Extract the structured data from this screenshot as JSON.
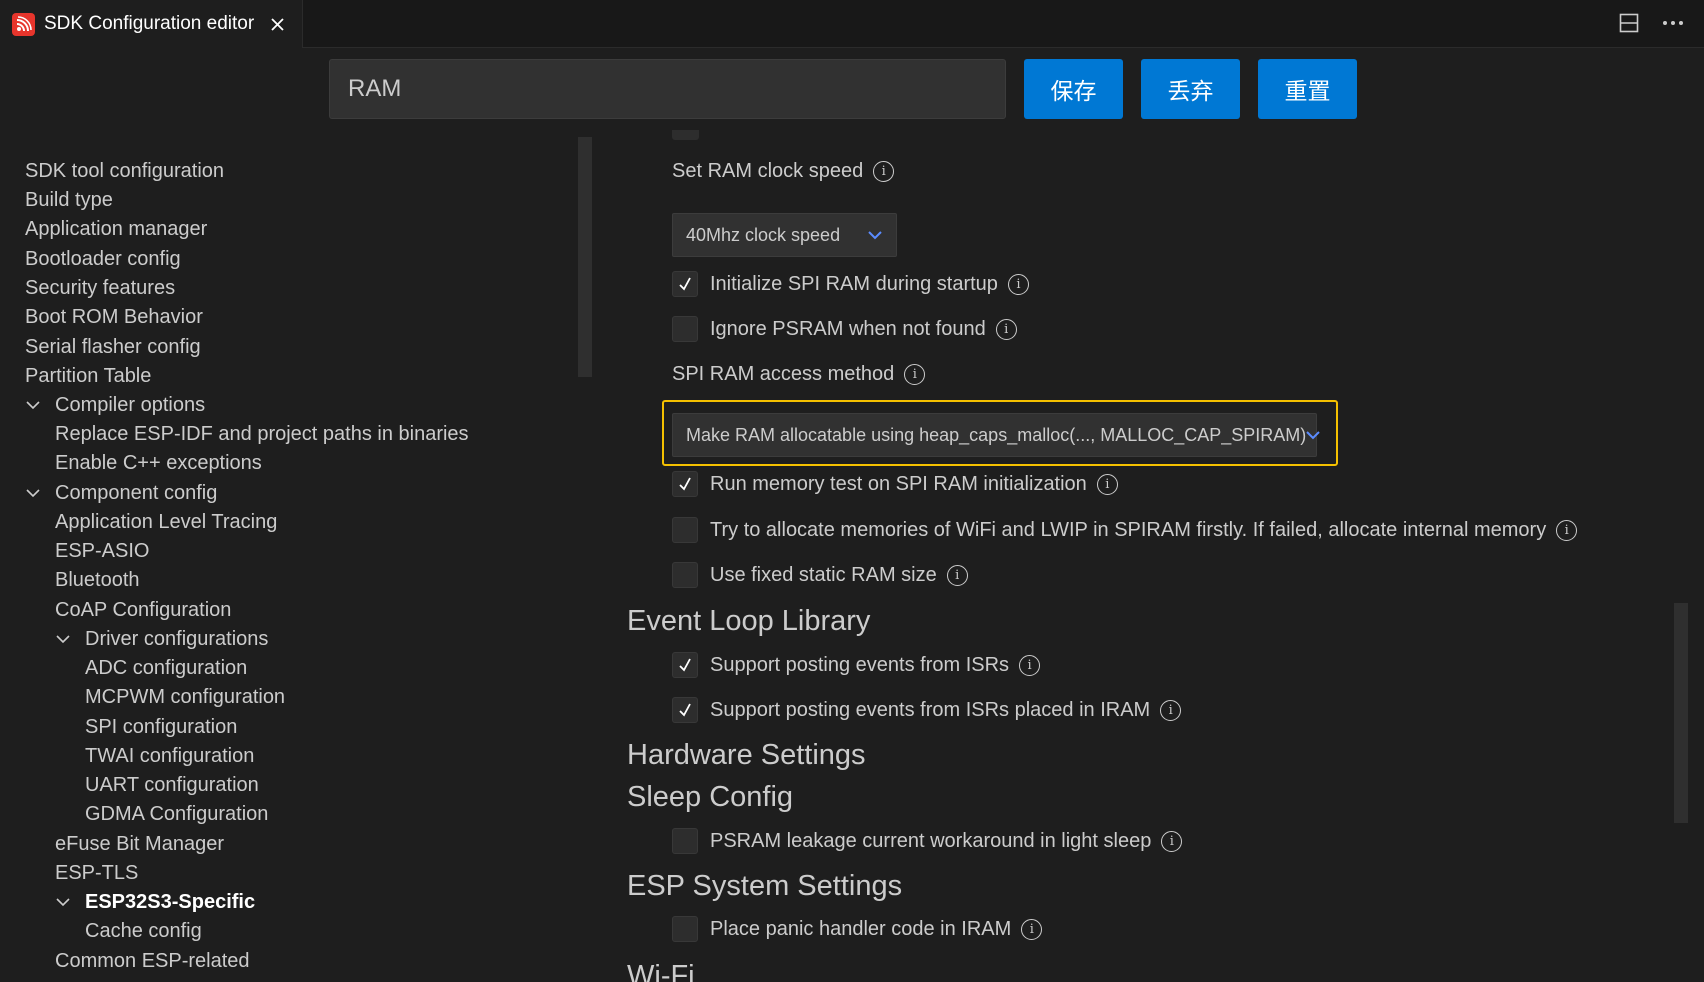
{
  "tab": {
    "title": "SDK Configuration editor",
    "logo_icon": "espressif-logo-icon",
    "close_icon": "close-icon"
  },
  "toolbar": {
    "split_icon": "split-editor-icon",
    "more_icon": "more-actions-icon"
  },
  "search": {
    "value": "RAM"
  },
  "buttons": {
    "save": "保存",
    "discard": "丢弃",
    "reset": "重置"
  },
  "sidebar": {
    "items": [
      {
        "label": "SDK tool configuration"
      },
      {
        "label": "Build type"
      },
      {
        "label": "Application manager"
      },
      {
        "label": "Bootloader config"
      },
      {
        "label": "Security features"
      },
      {
        "label": "Boot ROM Behavior"
      },
      {
        "label": "Serial flasher config"
      },
      {
        "label": "Partition Table"
      },
      {
        "label": "Compiler options"
      },
      {
        "label": "Replace ESP-IDF and project paths in binaries"
      },
      {
        "label": "Enable C++ exceptions"
      },
      {
        "label": "Component config"
      },
      {
        "label": "Application Level Tracing"
      },
      {
        "label": "ESP-ASIO"
      },
      {
        "label": "Bluetooth"
      },
      {
        "label": "CoAP Configuration"
      },
      {
        "label": "Driver configurations"
      },
      {
        "label": "ADC configuration"
      },
      {
        "label": "MCPWM configuration"
      },
      {
        "label": "SPI configuration"
      },
      {
        "label": "TWAI configuration"
      },
      {
        "label": "UART configuration"
      },
      {
        "label": "GDMA Configuration"
      },
      {
        "label": "eFuse Bit Manager"
      },
      {
        "label": "ESP-TLS"
      },
      {
        "label": "ESP32S3-Specific"
      },
      {
        "label": "Cache config"
      },
      {
        "label": "Common ESP-related"
      }
    ]
  },
  "main": {
    "ram_clock_label": "Set RAM clock speed",
    "ram_clock_value": "40Mhz clock speed",
    "init_spi_ram": "Initialize SPI RAM during startup",
    "ignore_psram": "Ignore PSRAM when not found",
    "access_method_label": "SPI RAM access method",
    "access_method_value": "Make RAM allocatable using heap_caps_malloc(..., MALLOC_CAP_SPIRAM)",
    "run_memtest": "Run memory test on SPI RAM initialization",
    "try_alloc_wifi": "Try to allocate memories of WiFi and LWIP in SPIRAM firstly. If failed, allocate internal memory",
    "fixed_static_ram": "Use fixed static RAM size",
    "section_event_loop": "Event Loop Library",
    "posting_isr": "Support posting events from ISRs",
    "posting_isr_iram": "Support posting events from ISRs placed in IRAM",
    "section_hardware": "Hardware Settings",
    "section_sleep": "Sleep Config",
    "psram_leakage": "PSRAM leakage current workaround in light sleep",
    "section_system": "ESP System Settings",
    "panic_iram": "Place panic handler code in IRAM",
    "section_wifi_partial": "Wi-Fi",
    "info_glyph": "i"
  }
}
